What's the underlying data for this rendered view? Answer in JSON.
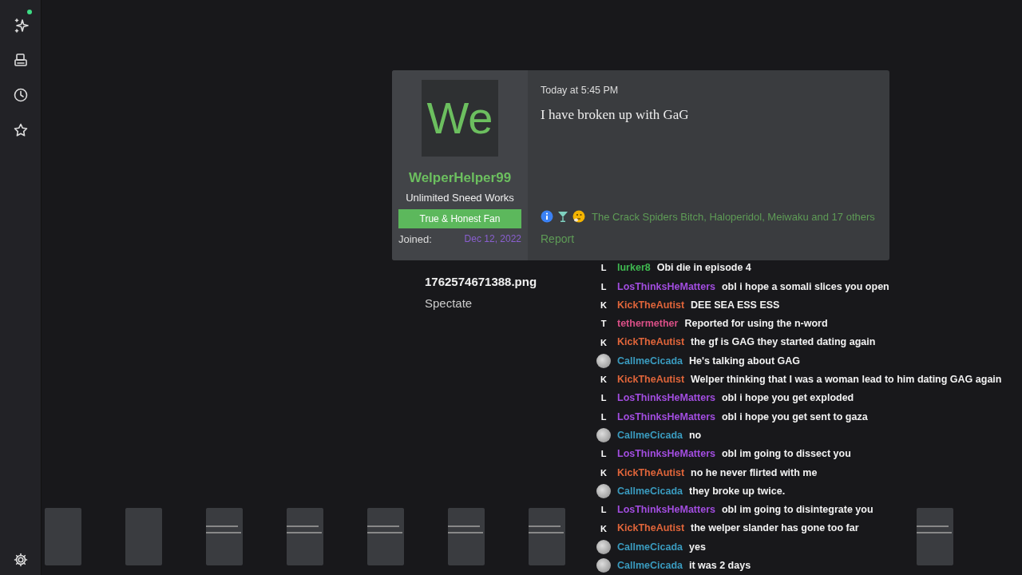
{
  "sidebar": {
    "items": [
      {
        "kind": "sparkle",
        "badge": true
      },
      {
        "kind": "device",
        "badge": false
      },
      {
        "kind": "clock",
        "badge": false
      },
      {
        "kind": "star",
        "badge": false
      }
    ],
    "footer": {
      "kind": "gear"
    }
  },
  "post": {
    "avatar_text": "We",
    "username": "WelperHelper99",
    "user_title": "Unlimited Sneed Works",
    "banner": "True & Honest Fan",
    "joined_label": "Joined:",
    "joined_date": "Dec 12, 2022",
    "time": "Today at 5:45 PM",
    "message": "I have broken up with GaG",
    "reactions": {
      "icons": [
        {
          "kind": "info"
        },
        {
          "kind": "cocktail"
        },
        {
          "kind": "thinking"
        }
      ],
      "text": "The Crack Spiders Bitch, Haloperidol, Meiwaku and 17 others"
    },
    "report": "Report"
  },
  "viewer": {
    "filename": "1762574671388.png",
    "caption": "Spectate"
  },
  "thumbnails": [
    {
      "kind": "plain"
    },
    {
      "kind": "plain"
    },
    {
      "kind": "lines"
    },
    {
      "kind": "lines"
    },
    {
      "kind": "lines"
    },
    {
      "kind": "lines"
    },
    {
      "kind": "lines"
    },
    {
      "kind": "lines"
    }
  ],
  "chat": [
    {
      "kind": "letter",
      "badge": "L",
      "user": "lurker8",
      "color": "#3fb950",
      "text": "Obi die in episode 4"
    },
    {
      "kind": "letter",
      "badge": "L",
      "user": "LosThinksHeMatters",
      "color": "#a24de0",
      "text": "obl i hope a somali slices you open"
    },
    {
      "kind": "letter",
      "badge": "K",
      "user": "KickTheAutist",
      "color": "#e0653a",
      "text": "DEE SEA ESS ESS"
    },
    {
      "kind": "letter",
      "badge": "T",
      "user": "tethermether",
      "color": "#d94f86",
      "text": "Reported for using the n-word"
    },
    {
      "kind": "letter",
      "badge": "K",
      "user": "KickTheAutist",
      "color": "#e0653a",
      "text": "the gf is GAG they started dating again"
    },
    {
      "kind": "avatar",
      "user": "CallmeCicada",
      "color": "#3a9bbf",
      "text": "He's talking about GAG"
    },
    {
      "kind": "letter",
      "badge": "K",
      "user": "KickTheAutist",
      "color": "#e0653a",
      "text": "Welper thinking that I was a woman lead to him dating GAG again"
    },
    {
      "kind": "letter",
      "badge": "L",
      "user": "LosThinksHeMatters",
      "color": "#a24de0",
      "text": "obl i hope you get exploded"
    },
    {
      "kind": "letter",
      "badge": "L",
      "user": "LosThinksHeMatters",
      "color": "#a24de0",
      "text": "obl i hope you get sent to gaza"
    },
    {
      "kind": "avatar",
      "user": "CallmeCicada",
      "color": "#3a9bbf",
      "text": "no"
    },
    {
      "kind": "letter",
      "badge": "L",
      "user": "LosThinksHeMatters",
      "color": "#a24de0",
      "text": "obl im going to dissect you"
    },
    {
      "kind": "letter",
      "badge": "K",
      "user": "KickTheAutist",
      "color": "#e0653a",
      "text": "no he never flirted with me"
    },
    {
      "kind": "avatar",
      "user": "CallmeCicada",
      "color": "#3a9bbf",
      "text": "they broke up twice."
    },
    {
      "kind": "letter",
      "badge": "L",
      "user": "LosThinksHeMatters",
      "color": "#a24de0",
      "text": "obl im going to disintegrate you"
    },
    {
      "kind": "letter",
      "badge": "K",
      "user": "KickTheAutist",
      "color": "#e0653a",
      "text": "the welper slander has gone too far"
    },
    {
      "kind": "avatar",
      "user": "CallmeCicada",
      "color": "#3a9bbf",
      "text": "yes"
    },
    {
      "kind": "avatar",
      "user": "CallmeCicada",
      "color": "#3a9bbf",
      "text": "it was 2 days"
    }
  ]
}
